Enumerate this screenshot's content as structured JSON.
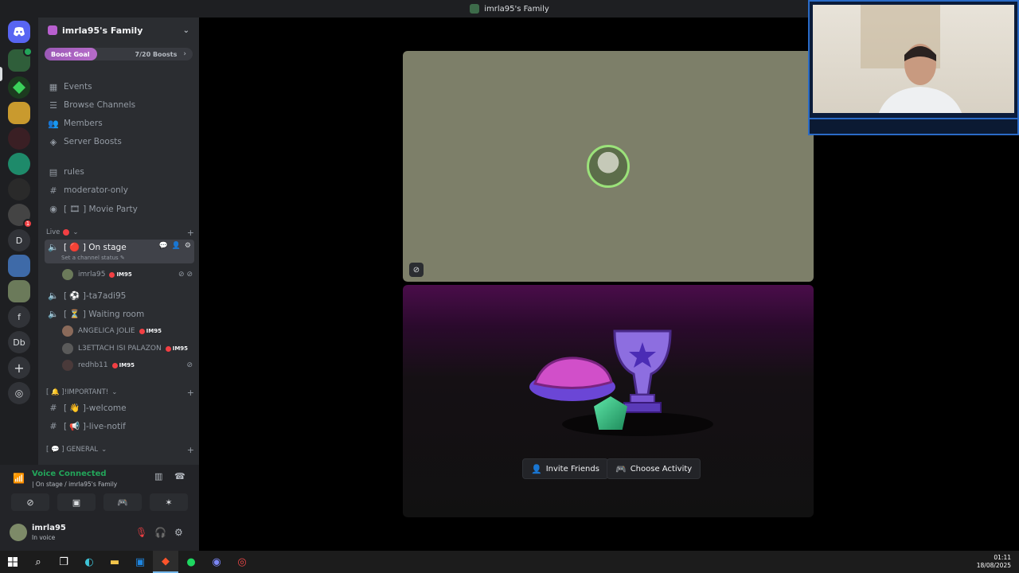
{
  "window": {
    "title": "imrla95's Family"
  },
  "server": {
    "name": "imrla95's Family",
    "boost_label": "Boost Goal",
    "boost_count": "7/20 Boosts"
  },
  "nav": [
    {
      "label": "Events",
      "icon": "calendar-icon"
    },
    {
      "label": "Browse Channels",
      "icon": "list-icon"
    },
    {
      "label": "Members",
      "icon": "members-icon"
    },
    {
      "label": "Server Boosts",
      "icon": "boost-icon"
    }
  ],
  "channels": {
    "rules": "rules",
    "moderator": "moderator-only",
    "movie": "[ 🎞 ] Movie Party",
    "live_cat": "Live",
    "on_stage": "[ 🔴 ] On stage",
    "status_hint": "Set a channel status",
    "ta7adi": "[ ⚽ ]-ta7adi95",
    "waiting": "[ ⏳ ] Waiting room",
    "important_cat": "[ 🔔 ]!IMPORTANT!",
    "welcome": "[ 👋 ]-welcome",
    "live_notif": "[ 📢 ]-live-notif",
    "general_cat": "[ 💬 ] GENERAL"
  },
  "voice_users": {
    "stage_user": "imrla95",
    "tag": "IM95",
    "waiting": [
      "ANGELICA JOLIE",
      "L3ETTACH ISI PALAZON",
      "redhb11"
    ]
  },
  "voice_panel": {
    "title": "Voice Connected",
    "subtitle": "| On stage / imrla95's Family"
  },
  "user_panel": {
    "name": "imrla95",
    "status": "In voice"
  },
  "activity": {
    "invite": "Invite Friends",
    "choose": "Choose Activity"
  },
  "guild_letters": [
    "D",
    "f",
    "Db"
  ],
  "clock": {
    "time": "01:11",
    "date": "18/08/2025"
  }
}
